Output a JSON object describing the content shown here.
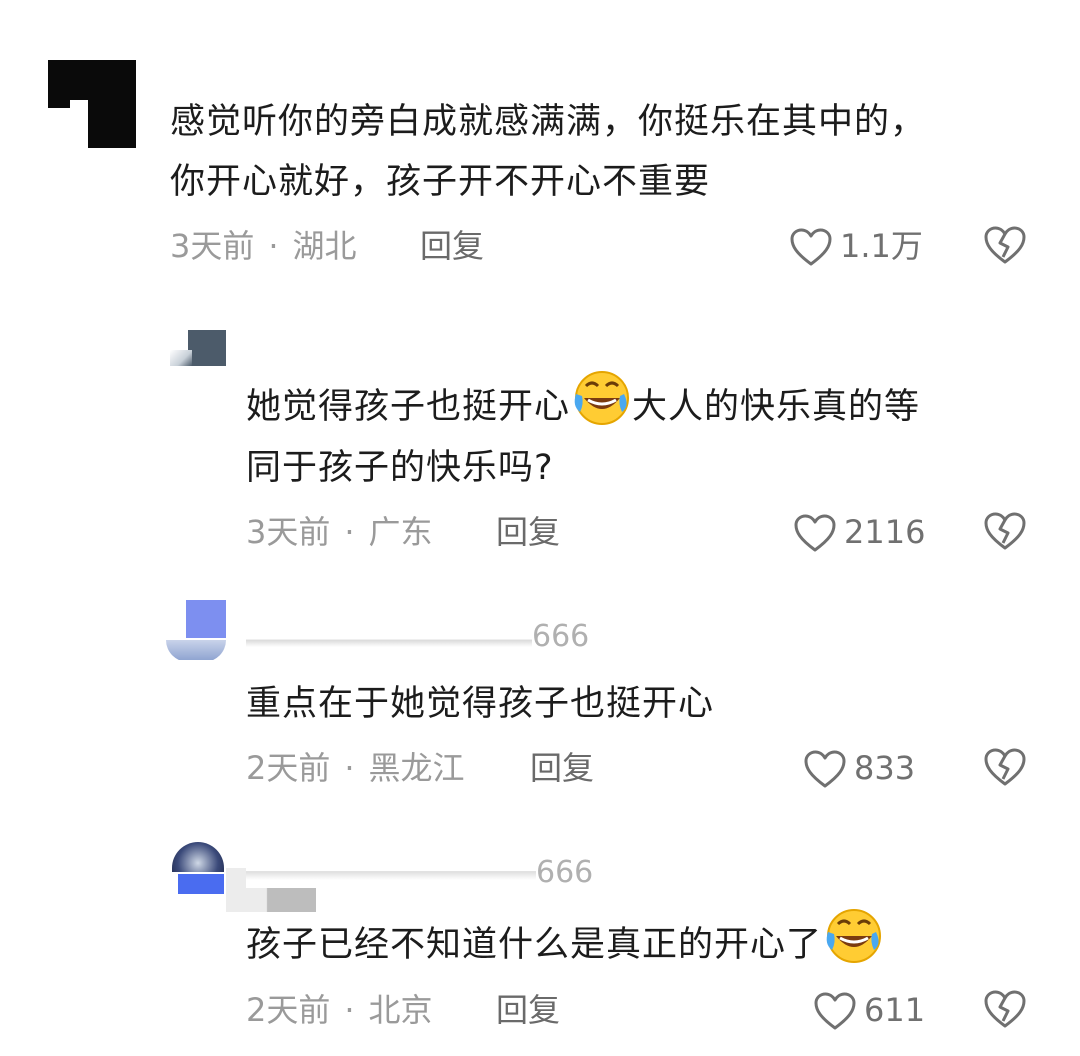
{
  "comments": [
    {
      "text_line1": "感觉听你的旁白成就感满满，你挺乐在其中的，",
      "text_line2": "你开心就好，孩子开不开心不重要",
      "time": "3天前",
      "location": "湖北",
      "reply_label": "回复",
      "likes": "1.1万"
    },
    {
      "text_line1_a": "她觉得孩子也挺开心",
      "text_line1_b": "大人的快乐真的等",
      "text_line2": "同于孩子的快乐吗?",
      "time": "3天前",
      "location": "广东",
      "reply_label": "回复",
      "likes": "2116"
    },
    {
      "nickname_fragment": "666",
      "text_line1": "重点在于她觉得孩子也挺开心",
      "time": "2天前",
      "location": "黑龙江",
      "reply_label": "回复",
      "likes": "833"
    },
    {
      "nickname_fragment": "666",
      "text_line1": "孩子已经不知道什么是真正的开心了",
      "time": "2天前",
      "location": "北京",
      "reply_label": "回复",
      "likes": "611"
    }
  ],
  "separator": "·",
  "icons": {
    "like": "heart-outline-icon",
    "dislike": "broken-heart-icon",
    "emoji": "rofl-emoji-icon"
  },
  "colors": {
    "text": "#1c1c1c",
    "meta": "#9a9a9a",
    "icon": "#707070"
  }
}
